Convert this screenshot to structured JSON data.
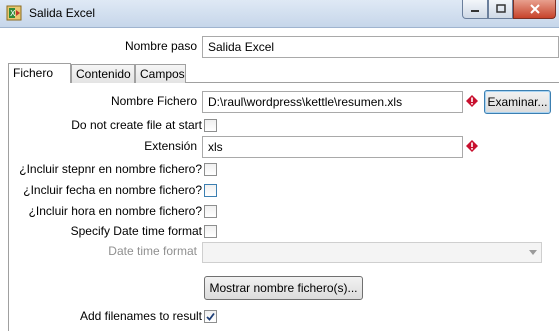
{
  "window": {
    "title": "Salida Excel",
    "app_icon": "excel-output-icon",
    "controls": [
      "minimize-icon",
      "maximize-icon",
      "close-icon"
    ]
  },
  "step": {
    "label": "Nombre paso",
    "value": "Salida Excel"
  },
  "tabs": [
    {
      "label": "Fichero",
      "active": true
    },
    {
      "label": "Contenido",
      "active": false
    },
    {
      "label": "Campos",
      "active": false
    }
  ],
  "fichero": {
    "filename_label": "Nombre Fichero",
    "filename_value": "D:\\raul\\wordpress\\kettle\\resumen.xls",
    "browse_button": "Examinar...",
    "do_not_create_label": "Do not create file at start",
    "do_not_create_checked": false,
    "extension_label": "Extensión",
    "extension_value": "xls",
    "include_stepnr_label": "¿Incluir stepnr en nombre fichero?",
    "include_stepnr_checked": false,
    "include_date_label": "¿Incluir fecha en nombre fichero?",
    "include_date_checked": false,
    "include_time_label": "¿Incluir hora en nombre fichero?",
    "include_time_checked": false,
    "specify_datetime_label": "Specify Date time format",
    "specify_datetime_checked": false,
    "datetime_format_label": "Date time format",
    "datetime_format_value": "",
    "show_filenames_button": "Mostrar nombre fichero(s)...",
    "add_filenames_label": "Add filenames to result",
    "add_filenames_checked": true
  },
  "colors": {
    "warning": "#c8102e",
    "titlebar": "#c6d6ea"
  }
}
